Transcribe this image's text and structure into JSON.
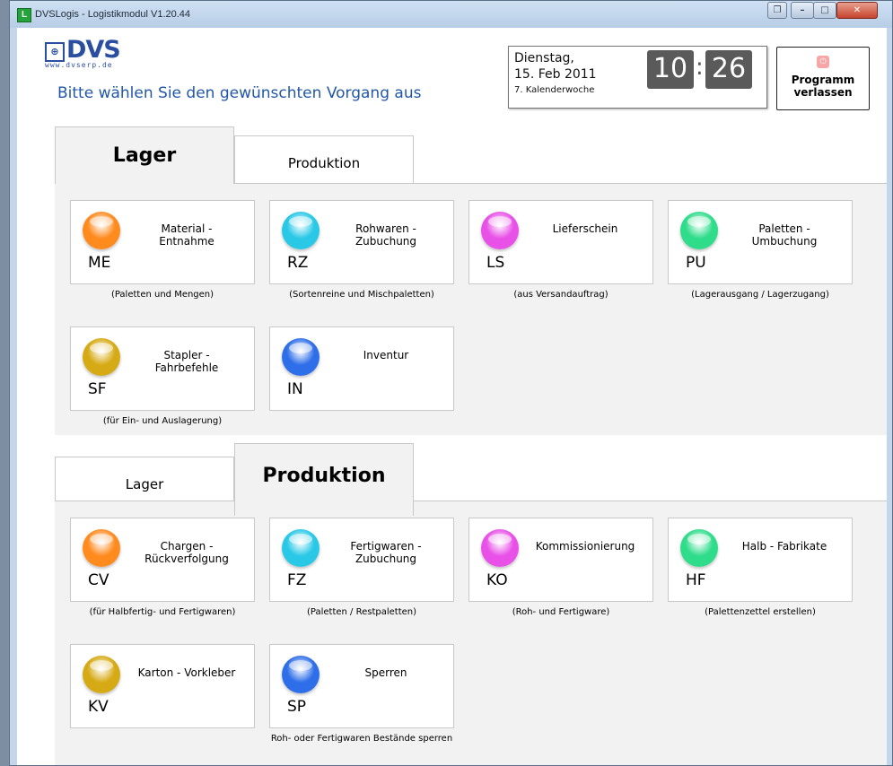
{
  "window": {
    "title": "DVSLogis - Logistikmodul V1.20.44",
    "app_icon_letter": "L",
    "restore_glyph": "❐",
    "minimize_glyph": "–",
    "maximize_glyph": "□",
    "close_glyph": "✕"
  },
  "logo": {
    "brand": "DVS",
    "mark": "⊕",
    "url": "www.dvserp.de"
  },
  "prompt": "Bitte wählen Sie den gewünschten Vorgang aus",
  "datetime": {
    "weekday": "Dienstag,",
    "date": "15. Feb 2011",
    "week": "7. Kalenderwoche",
    "hour": "10",
    "minute": "26",
    "separator": ":"
  },
  "exit_button": {
    "icon_glyph": "⏻",
    "line1": "Programm",
    "line2": "verlassen"
  },
  "colors": {
    "orange": "#ff8a1e",
    "cyan": "#28c8e6",
    "magenta": "#e850e8",
    "green": "#2edc8a",
    "gold": "#d6aa14",
    "blue": "#2e6ee8"
  },
  "lager_section": {
    "tabs": [
      "Lager",
      "Produktion"
    ],
    "cards": [
      {
        "code": "ME",
        "title1": "Material -",
        "title2": "Entnahme",
        "caption": "(Paletten und Mengen)",
        "color": "#ff8a1e",
        "icon": "orange-ball-icon"
      },
      {
        "code": "RZ",
        "title1": "Rohwaren -",
        "title2": "Zubuchung",
        "caption": "(Sortenreine und Mischpaletten)",
        "color": "#28c8e6",
        "icon": "cyan-ball-icon"
      },
      {
        "code": "LS",
        "title1": "Lieferschein",
        "title2": "",
        "caption": "(aus Versandauftrag)",
        "color": "#e850e8",
        "icon": "magenta-ball-icon"
      },
      {
        "code": "PU",
        "title1": "Paletten -",
        "title2": "Umbuchung",
        "caption": "(Lagerausgang / Lagerzugang)",
        "color": "#2edc8a",
        "icon": "green-ball-icon"
      },
      {
        "code": "SF",
        "title1": "Stapler -",
        "title2": "Fahrbefehle",
        "caption": "(für Ein- und Auslagerung)",
        "color": "#d6aa14",
        "icon": "gold-ball-icon"
      },
      {
        "code": "IN",
        "title1": "Inventur",
        "title2": "",
        "caption": "",
        "color": "#2e6ee8",
        "icon": "blue-ball-icon"
      }
    ]
  },
  "produktion_section": {
    "tabs": [
      "Lager",
      "Produktion"
    ],
    "cards": [
      {
        "code": "CV",
        "title1": "Chargen -",
        "title2": "Rückverfolgung",
        "caption": "(für Halbfertig- und Fertigwaren)",
        "color": "#ff8a1e",
        "icon": "orange-ball-icon"
      },
      {
        "code": "FZ",
        "title1": "Fertigwaren -",
        "title2": "Zubuchung",
        "caption": "(Paletten / Restpaletten)",
        "color": "#28c8e6",
        "icon": "cyan-ball-icon"
      },
      {
        "code": "KO",
        "title1": "Kommissionierung",
        "title2": "",
        "caption": "(Roh- und Fertigware)",
        "color": "#e850e8",
        "icon": "magenta-ball-icon"
      },
      {
        "code": "HF",
        "title1": "Halb - Fabrikate",
        "title2": "",
        "caption": "(Palettenzettel erstellen)",
        "color": "#2edc8a",
        "icon": "green-ball-icon"
      },
      {
        "code": "KV",
        "title1": "Karton - Vorkleber",
        "title2": "",
        "caption": "",
        "color": "#d6aa14",
        "icon": "gold-ball-icon"
      },
      {
        "code": "SP",
        "title1": "Sperren",
        "title2": "",
        "caption": "Roh- oder Fertigwaren Bestände sperren",
        "color": "#2e6ee8",
        "icon": "blue-ball-icon"
      }
    ]
  }
}
